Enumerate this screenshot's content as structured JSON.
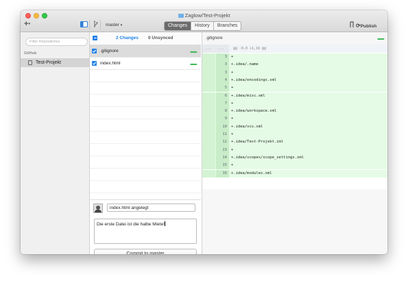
{
  "window": {
    "title": "Zaglow/Test-Projekt"
  },
  "toolbar": {
    "add_label": "+",
    "branch": "master",
    "tabs": [
      {
        "label": "Changes",
        "active": true
      },
      {
        "label": "History",
        "active": false
      },
      {
        "label": "Branches",
        "active": false
      }
    ],
    "sync_label": "Publish"
  },
  "sidebar": {
    "filter_placeholder": "Filter Repositories",
    "section": "GitHub",
    "repos": [
      {
        "label": "Test-Projekt",
        "selected": true
      }
    ]
  },
  "changes": {
    "tab_changes": "2 Changes",
    "tab_unsynced": "0 Unsynced",
    "files": [
      {
        "name": ".gitignore",
        "checked": true,
        "selected": true,
        "stat": "■■■■■"
      },
      {
        "name": "index.html",
        "checked": true,
        "selected": false,
        "stat": "■■■■■"
      }
    ]
  },
  "commit": {
    "summary": "index.html angelegt",
    "description": "Die erste Datei ist die halbe Miete!",
    "button": "Commit to master"
  },
  "diff": {
    "file": ".gitignore",
    "stat": "■■■■■",
    "hunk_gutter_old": "...",
    "hunk_gutter_new": "...",
    "hunk_header": "@@ -0,0 +1,16 @@",
    "lines": [
      {
        "num": "3",
        "text": "+"
      },
      {
        "num": "3",
        "text": "+.idea/.name"
      },
      {
        "num": "3",
        "text": "+"
      },
      {
        "num": "4",
        "text": "+.idea/encodings.xml"
      },
      {
        "num": "5",
        "text": "+"
      },
      {
        "num": "6",
        "text": "+.idea/misc.xml"
      },
      {
        "num": "7",
        "text": "+"
      },
      {
        "num": "8",
        "text": "+.idea/workspace.xml"
      },
      {
        "num": "9",
        "text": "+"
      },
      {
        "num": "10",
        "text": "+.idea/vcs.xml"
      },
      {
        "num": "11",
        "text": "+"
      },
      {
        "num": "12",
        "text": "+.idea/Test-Projekt.iml"
      },
      {
        "num": "13",
        "text": "+"
      },
      {
        "num": "14",
        "text": "+.idea/scopes/scope_settings.xml"
      },
      {
        "num": "15",
        "text": "+"
      },
      {
        "num": "16",
        "text": "+.idea/modules.xml"
      }
    ]
  },
  "colors": {
    "accent": "#1e82ea",
    "added_bg": "#e5fbe5",
    "stat_green": "#2fb64a"
  }
}
